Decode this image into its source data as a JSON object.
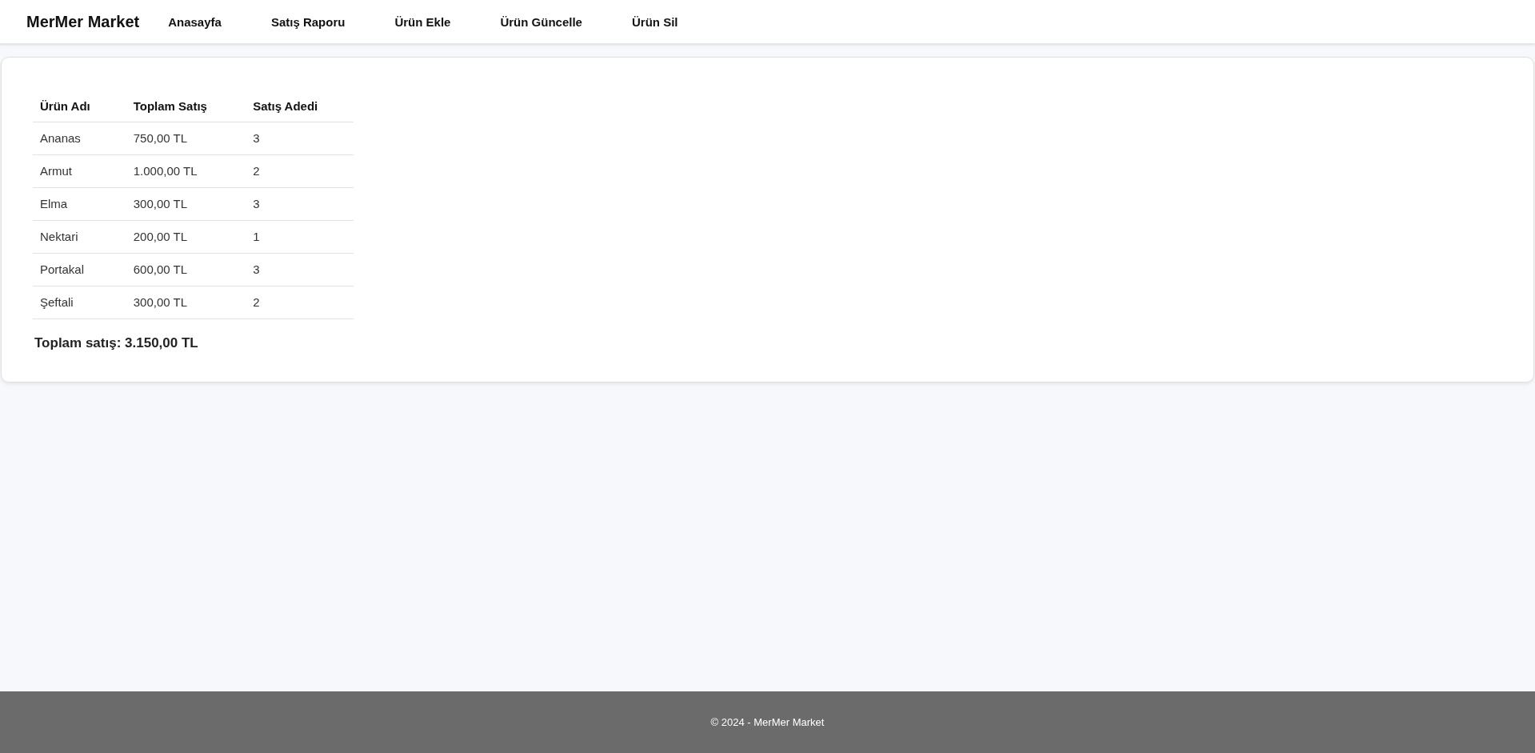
{
  "brand": "MerMer Market",
  "nav": [
    "Anasayfa",
    "Satış Raporu",
    "Ürün Ekle",
    "Ürün Güncelle",
    "Ürün Sil"
  ],
  "table": {
    "columns": [
      "Ürün Adı",
      "Toplam Satış",
      "Satış Adedi"
    ],
    "rows": [
      [
        "Ananas",
        "750,00 TL",
        "3"
      ],
      [
        "Armut",
        "1.000,00 TL",
        "2"
      ],
      [
        "Elma",
        "300,00 TL",
        "3"
      ],
      [
        "Nektari",
        "200,00 TL",
        "1"
      ],
      [
        "Portakal",
        "600,00 TL",
        "3"
      ],
      [
        "Şeftali",
        "300,00 TL",
        "2"
      ]
    ]
  },
  "total": "Toplam satış: 3.150,00 TL",
  "footer": "© 2024 - MerMer Market"
}
